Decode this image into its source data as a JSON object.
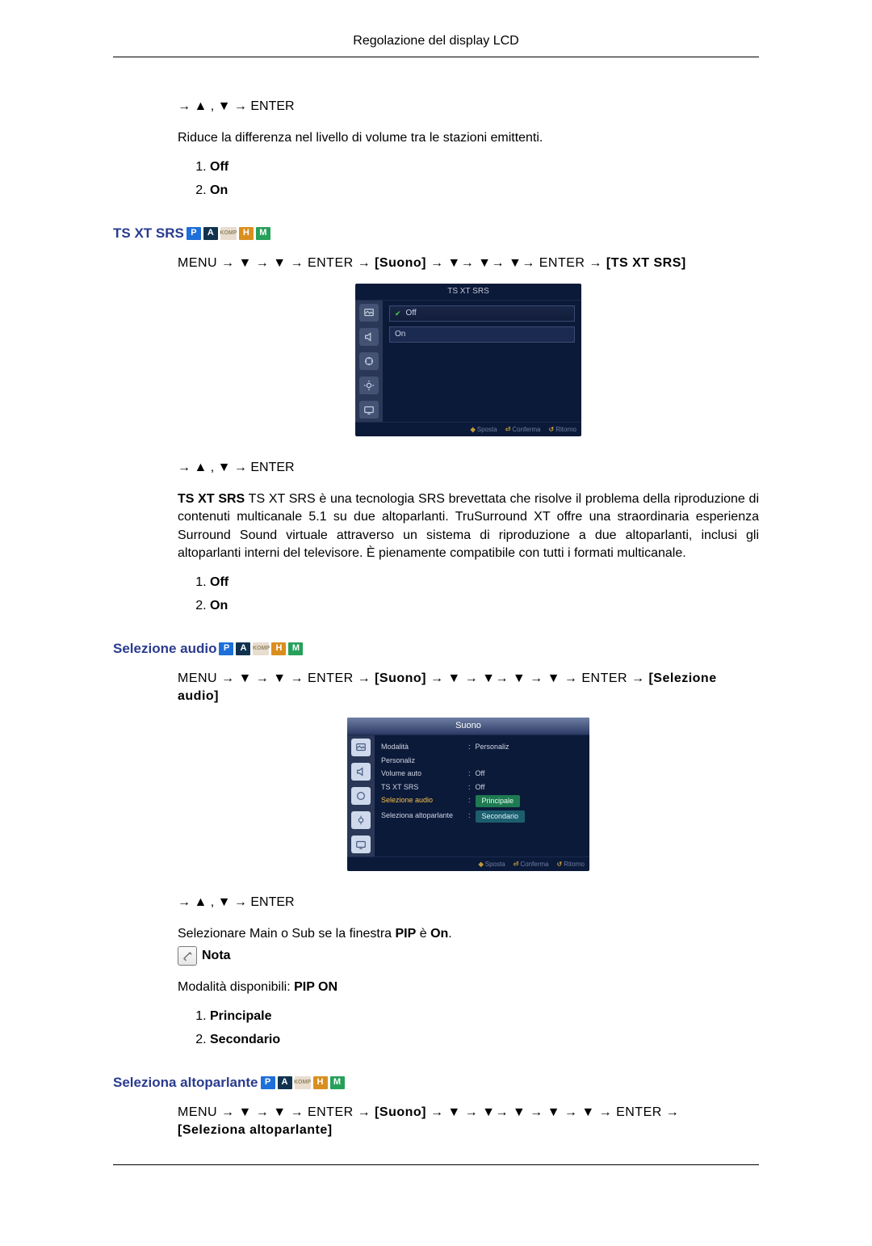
{
  "header": {
    "title": "Regolazione del display LCD"
  },
  "nav": {
    "simple": "→ ▲ , ▼ → ENTER",
    "menu_prefix": "MENU → ▼ → ▼ → ENTER → ",
    "menu_prefix_spaced": "MENU  →  ▼  →  ▼  →  ENTER  →  ",
    "suono": "[Suono]",
    "ts_mid": " → ▼→ ▼→ ▼→ ENTER → ",
    "ts_end": "[TS XT SRS]",
    "selaudio_mid": " → ▼ → ▼→ ▼ → ▼ → ENTER → ",
    "selaudio_end": "[Selezione audio]",
    "selalt_mid": "  →  ▼  →  ▼→ ▼  →  ▼  →  ▼  →  ENTER  →",
    "selalt_end": "[Seleziona altoparlante]"
  },
  "intro": {
    "volume_auto_desc": "Riduce la differenza nel livello di volume tra le stazioni emittenti.",
    "off": "Off",
    "on": "On"
  },
  "ts": {
    "heading": "TS XT SRS",
    "desc": "TS XT SRS è una tecnologia SRS brevettata che risolve il problema della riproduzione di contenuti multicanale 5.1 su due altoparlanti. TruSurround XT offre una straordinaria esperienza Surround Sound virtuale attraverso un sistema di riproduzione a due altoparlanti, inclusi gli altoparlanti interni del televisore. È pienamente compatibile con tutti i formati multicanale.",
    "off": "Off",
    "on": "On",
    "osd": {
      "title": "TS XT SRS",
      "opt_off": "Off",
      "opt_on": "On",
      "foot_move": "Sposta",
      "foot_enter": "Conferma",
      "foot_return": "Ritorno"
    }
  },
  "selaudio": {
    "heading": "Selezione audio",
    "desc_pre": "Selezionare Main o Sub se la finestra ",
    "desc_pip": "PIP",
    "desc_mid": " è ",
    "desc_on": "On",
    "desc_post": ".",
    "note": "Nota",
    "modes_pre": "Modalità disponibili: ",
    "modes_bold": "PIP ON",
    "opt1": "Principale",
    "opt2": "Secondario",
    "osd": {
      "title": "Suono",
      "rows": {
        "modalita": "Modalità",
        "modalita_val": "Personaliz",
        "personaliz": "Personaliz",
        "volume_auto": "Volume auto",
        "volume_auto_val": "Off",
        "ts": "TS XT SRS",
        "ts_val": "Off",
        "selaudio": "Selezione audio",
        "selaudio_val": "Principale",
        "selalt": "Seleziona altoparlante",
        "selalt_val": "Secondario"
      },
      "foot_move": "Sposta",
      "foot_enter": "Conferma",
      "foot_return": "Ritorno"
    }
  },
  "selalt": {
    "heading": "Seleziona altoparlante"
  },
  "badges": {
    "p": "P",
    "a": "A",
    "k": "KOMP",
    "h": "H",
    "m": "M"
  }
}
